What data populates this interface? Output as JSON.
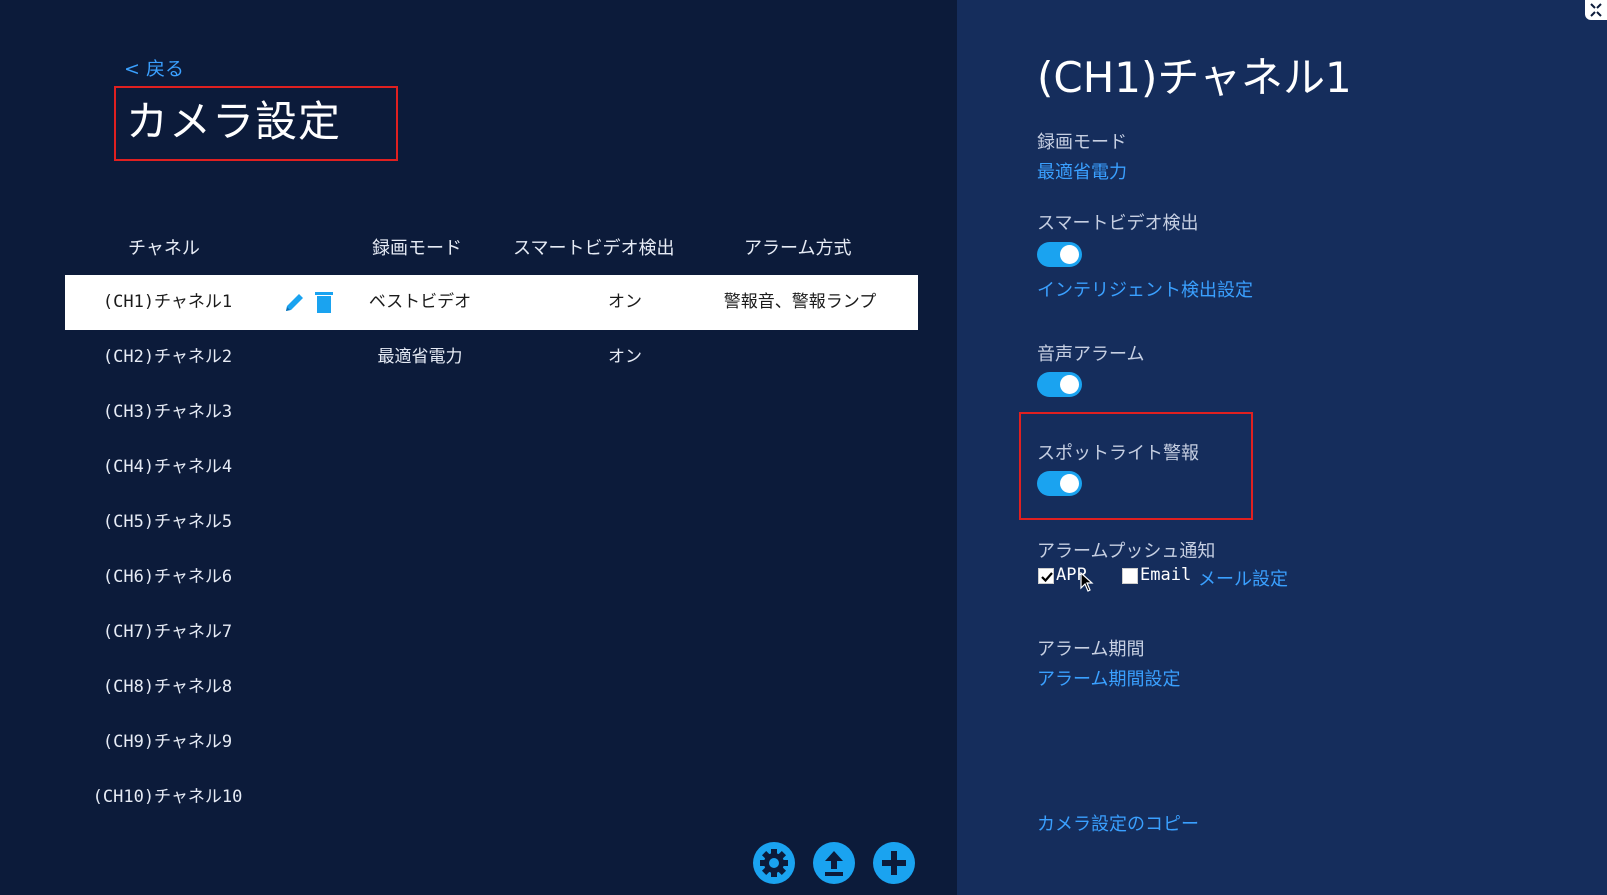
{
  "nav": {
    "back_label": "< 戻る"
  },
  "page": {
    "title": "カメラ設定"
  },
  "table": {
    "headers": {
      "channel": "チャネル",
      "mode": "録画モード",
      "smart": "スマートビデオ検出",
      "alarm": "アラーム方式"
    },
    "rows": [
      {
        "channel": "(CH1)チャネル1",
        "mode": "ベストビデオ",
        "smart": "オン",
        "alarm": "警報音、警報ランプ"
      },
      {
        "channel": "(CH2)チャネル2",
        "mode": "最適省電力",
        "smart": "オン",
        "alarm": ""
      },
      {
        "channel": "(CH3)チャネル3",
        "mode": "",
        "smart": "",
        "alarm": ""
      },
      {
        "channel": "(CH4)チャネル4",
        "mode": "",
        "smart": "",
        "alarm": ""
      },
      {
        "channel": "(CH5)チャネル5",
        "mode": "",
        "smart": "",
        "alarm": ""
      },
      {
        "channel": "(CH6)チャネル6",
        "mode": "",
        "smart": "",
        "alarm": ""
      },
      {
        "channel": "(CH7)チャネル7",
        "mode": "",
        "smart": "",
        "alarm": ""
      },
      {
        "channel": "(CH8)チャネル8",
        "mode": "",
        "smart": "",
        "alarm": ""
      },
      {
        "channel": "(CH9)チャネル9",
        "mode": "",
        "smart": "",
        "alarm": ""
      },
      {
        "channel": "(CH10)チャネル10",
        "mode": "",
        "smart": "",
        "alarm": ""
      }
    ],
    "selected_row_icons": [
      "pencil-icon",
      "trash-icon"
    ]
  },
  "toolbar": {
    "icons": [
      "gear-icon",
      "upload-icon",
      "plus-icon"
    ]
  },
  "panel": {
    "title": "(CH1)チャネル1",
    "record_mode": {
      "label": "録画モード",
      "value": "最適省電力"
    },
    "smart_video": {
      "label": "スマートビデオ検出",
      "enabled": true,
      "link": "インテリジェント検出設定"
    },
    "audio_alarm": {
      "label": "音声アラーム",
      "enabled": true
    },
    "spotlight": {
      "label": "スポットライト警報",
      "enabled": true
    },
    "push": {
      "label": "アラームプッシュ通知",
      "app_label": "APP",
      "app_checked": true,
      "email_label": "Email",
      "email_checked": false,
      "mail_link": "メール設定"
    },
    "alarm_period": {
      "label": "アラーム期間",
      "link": "アラーム期間設定"
    },
    "copy_link": "カメラ設定のコピー"
  },
  "colors": {
    "bg_left": "#0c1b3a",
    "bg_right": "#152d5c",
    "accent": "#1aa3f0",
    "link": "#3aa0ff",
    "highlight": "#e02020"
  }
}
